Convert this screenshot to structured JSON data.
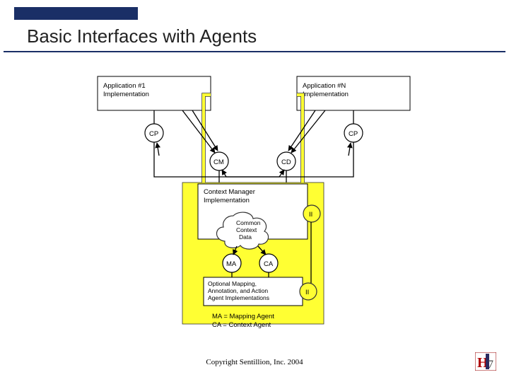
{
  "slide": {
    "title": "Basic Interfaces with Agents",
    "copyright": "Copyright Sentillion, Inc. 2004"
  },
  "apps": {
    "left": {
      "line1": "Application #1",
      "line2": "Implementation"
    },
    "right": {
      "line1": "Application #N",
      "line2": "Implementation"
    }
  },
  "nodes": {
    "cp": "CP",
    "cm": "CM",
    "cd": "CD",
    "ma": "MA",
    "ca": "CA",
    "ii": "II"
  },
  "cmi": {
    "line1": "Context Manager",
    "line2": "Implementation"
  },
  "cloud": {
    "line1": "Common",
    "line2": "Context",
    "line3": "Data"
  },
  "agents": {
    "line1": "Optional Mapping,",
    "line2": "Annotation, and Action",
    "line3": "Agent Implementations"
  },
  "legend": {
    "line1": "MA = Mapping Agent",
    "line2": "CA = Context Agent"
  },
  "colors": {
    "accent": "#1a2f66",
    "yellow": "#ffff33"
  }
}
